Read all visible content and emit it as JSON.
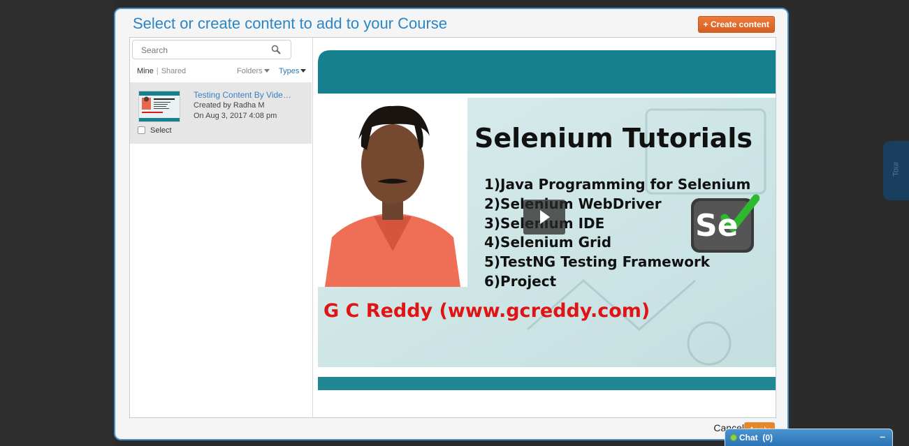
{
  "modal": {
    "title": "Select or create content to add to your Course",
    "create_label": "+ Create content",
    "cancel_label": "Cancel",
    "apply_label": "Apply"
  },
  "search": {
    "placeholder": "Search"
  },
  "filters": {
    "mine": "Mine",
    "separator": "|",
    "shared": "Shared",
    "folders": "Folders",
    "types": "Types"
  },
  "items": [
    {
      "title": "Testing Content By Vide…",
      "created_by": "Created by Radha M",
      "created_on": "On Aug 3, 2017 4:08 pm",
      "select_label": "Select",
      "checked": false
    }
  ],
  "preview": {
    "slide_title": "Selenium Tutorials",
    "topics": [
      "1)Java Programming for Selenium",
      "2)Selenium WebDriver",
      "3)Selenium IDE",
      "4)Selenium Grid",
      "5)TestNG Testing Framework",
      "6)Project"
    ],
    "author_line": "G C Reddy (www.gcreddy.com)",
    "logo_text": "Se"
  },
  "tour": {
    "label": "Tour"
  },
  "chat": {
    "label": "Chat",
    "count": "(0)",
    "minimize": "–"
  },
  "colors": {
    "accent": "#2a86c6",
    "create_button": "#e06a28",
    "teal_band": "#15818f",
    "author_red": "#e01414"
  }
}
